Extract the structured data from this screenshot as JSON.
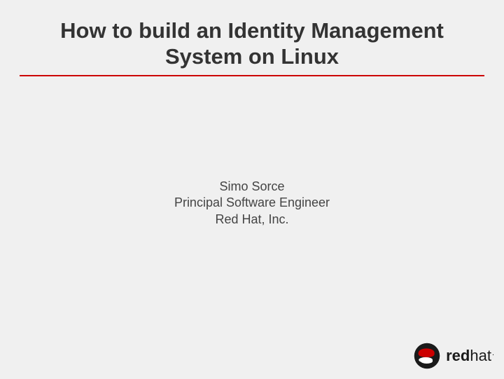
{
  "title": "How to build an Identity Management System on Linux",
  "author": {
    "name": "Simo Sorce",
    "role": "Principal Software Engineer",
    "company": "Red Hat, Inc."
  },
  "logo": {
    "text_bold": "red",
    "text_normal": "hat",
    "trademark": ".",
    "colors": {
      "red": "#cc0000",
      "black": "#1a1a1a",
      "white": "#ffffff"
    }
  }
}
